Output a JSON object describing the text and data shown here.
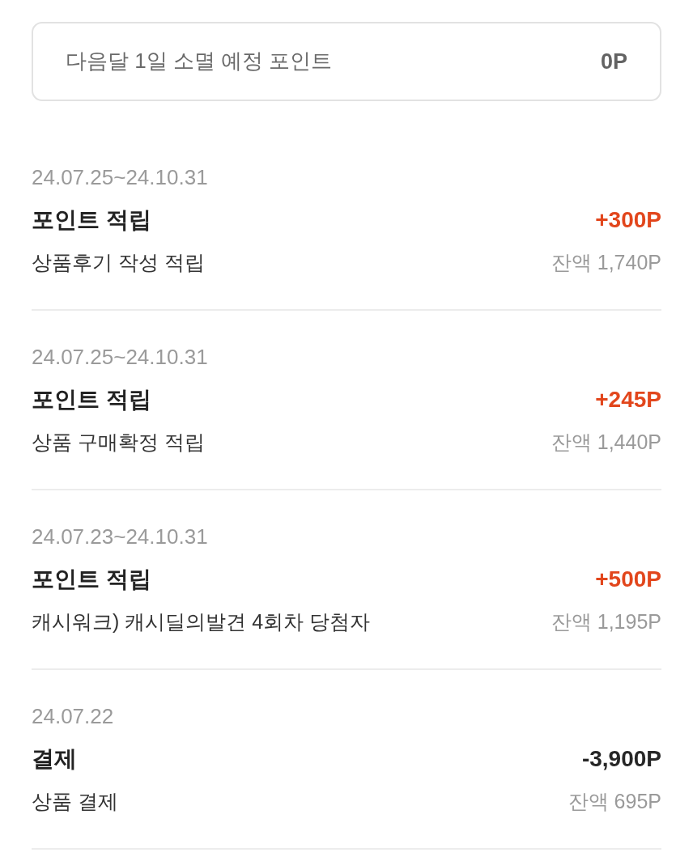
{
  "expiring": {
    "label": "다음달 1일 소멸 예정 포인트",
    "amount": "0P"
  },
  "entries": [
    {
      "kind": "earn",
      "period": "24.07.25~24.10.31",
      "title": "포인트 적립",
      "amount": "+300P",
      "description": "상품후기 작성 적립",
      "balance": "잔액 1,740P"
    },
    {
      "kind": "earn",
      "period": "24.07.25~24.10.31",
      "title": "포인트 적립",
      "amount": "+245P",
      "description": "상품 구매확정 적립",
      "balance": "잔액 1,440P"
    },
    {
      "kind": "earn",
      "period": "24.07.23~24.10.31",
      "title": "포인트 적립",
      "amount": "+500P",
      "description": "캐시워크) 캐시딜의발견 4회차 당첨자",
      "balance": "잔액 1,195P"
    },
    {
      "kind": "use",
      "period": "24.07.22",
      "title": "결제",
      "amount": "-3,900P",
      "description": "상품 결제",
      "balance": "잔액 695P"
    }
  ]
}
